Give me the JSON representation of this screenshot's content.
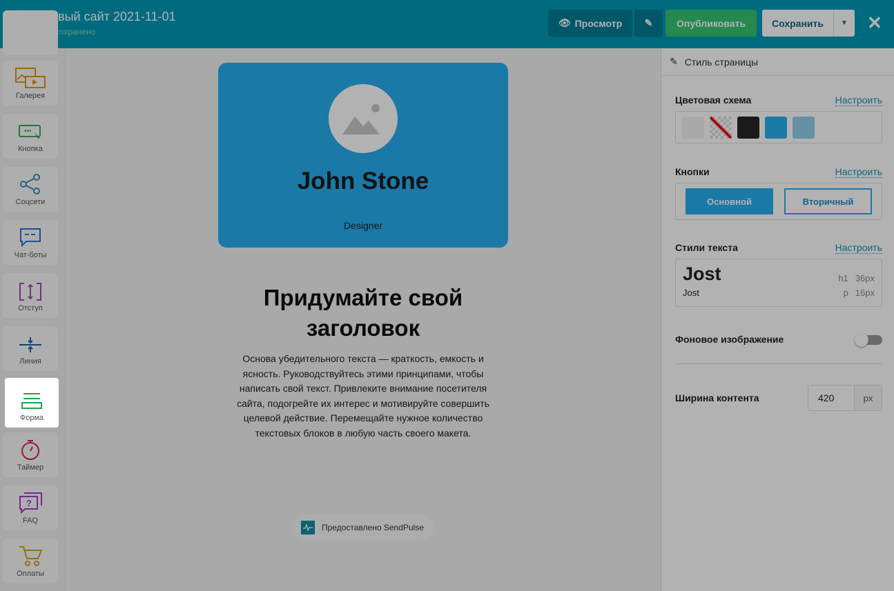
{
  "header": {
    "title": "Новый сайт 2021-11-01",
    "status": "Не сохранено",
    "preview": "Просмотр",
    "publish": "Опубликовать",
    "save": "Сохранить"
  },
  "sidebar": {
    "items": [
      {
        "label": "Галерея"
      },
      {
        "label": "Кнопка"
      },
      {
        "label": "Соцсети"
      },
      {
        "label": "Чат-боты"
      },
      {
        "label": "Отступ"
      },
      {
        "label": "Линия"
      },
      {
        "label": "Форма"
      },
      {
        "label": "Таймер"
      },
      {
        "label": "FAQ"
      },
      {
        "label": "Оплаты"
      }
    ]
  },
  "canvas": {
    "name": "John Stone",
    "role": "Designer",
    "headline": "Придумайте свой заголовок",
    "paragraph": "Основа убедительного текста — краткость, емкость и ясность. Руководствуйтесь этими принципами, чтобы написать свой текст. Привлеките внимание посетителя сайта, подогрейте их интерес и мотивируйте совершить целевой действие. Перемещайте нужное количество текстовых блоков в любую часть своего макета.",
    "badge": "Предоставлено SendPulse"
  },
  "panel": {
    "title": "Стиль страницы",
    "color_scheme": "Цветовая схема",
    "configure": "Настроить",
    "colors": [
      "#f2f2f2",
      "transparent",
      "#262626",
      "#27aef0",
      "#94cfee"
    ],
    "buttons": "Кнопки",
    "primary": "Основной",
    "secondary": "Вторичный",
    "text_styles": "Стили текста",
    "font_h": "Jost",
    "font_p": "Jost",
    "h1_label": "h1",
    "h1_size": "36px",
    "p_label": "p",
    "p_size": "16px",
    "bg_image": "Фоновое изображение",
    "bg_image_on": false,
    "content_width": "Ширина контента",
    "width_value": "420",
    "width_unit": "px"
  }
}
